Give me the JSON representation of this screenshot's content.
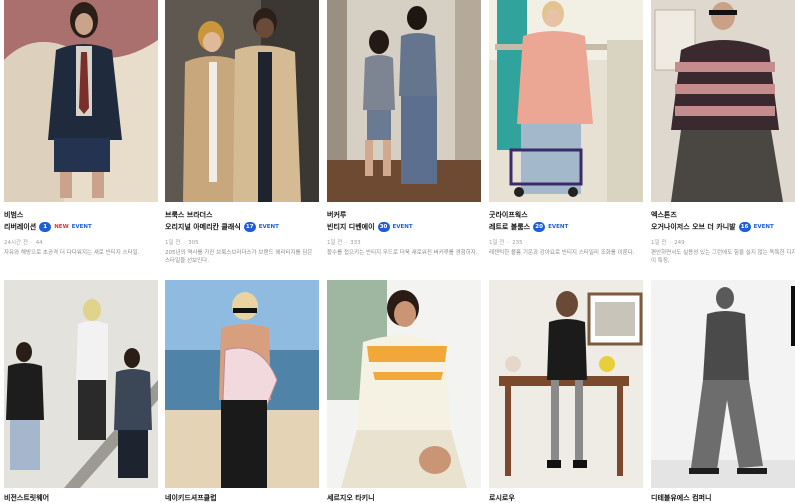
{
  "cards": [
    {
      "brand": "비범스",
      "title": "리버레이션",
      "count": "1",
      "new_label": "NEW",
      "event_label": "EVENT",
      "time": "24시간 전",
      "views": "44",
      "desc": "자유와 해방으로 초공격 더 다다워지는 새로 빈티지 스타일."
    },
    {
      "brand": "브룩스 브라더스",
      "title": "오리지널 아메리칸 클래식",
      "count": "17",
      "event_label": "EVENT",
      "time": "1일 전",
      "views": "305",
      "desc": "205년의 역사를 가진 브룩스브라더스가 브랜드 헤리티지를 담은 스타일을 선보인다."
    },
    {
      "brand": "버커루",
      "title": "빈티지 디벤에이",
      "count": "30",
      "event_label": "EVENT",
      "time": "1일 전",
      "views": "333",
      "desc": "황수를 접으키는 빈티지 무드로 더욱 새로워진 버커루를 경험하자."
    },
    {
      "brand": "굿라이프웍스",
      "title": "레트로 볼룸스",
      "count": "20",
      "event_label": "EVENT",
      "time": "1일 전",
      "views": "235",
      "desc": "레젠틱한 볼륨 기운과 강아요로 빈티지 스타일리 조화를 이룬다."
    },
    {
      "brand": "엑스톤즈",
      "title": "오거나이저스 오브 더 카니발",
      "count": "16",
      "event_label": "EVENT",
      "time": "1일 전",
      "views": "249",
      "desc": "편안하면서도 실용성 있는 그런에도 힘을 실지 않는 독특한 디자인이 특징."
    }
  ],
  "bottom_cards": [
    {
      "brand": "비전스트릿웨어"
    },
    {
      "brand": "네이키드셔프클럽"
    },
    {
      "brand": "세르지오 타키니"
    },
    {
      "brand": "로시로우"
    },
    {
      "brand": "디테블유에스 컴퍼니"
    }
  ],
  "colors": {
    "accent_blue": "#1d5ed8",
    "new_red": "#e5322d"
  },
  "icons": [
    "photo-thumbnail"
  ]
}
